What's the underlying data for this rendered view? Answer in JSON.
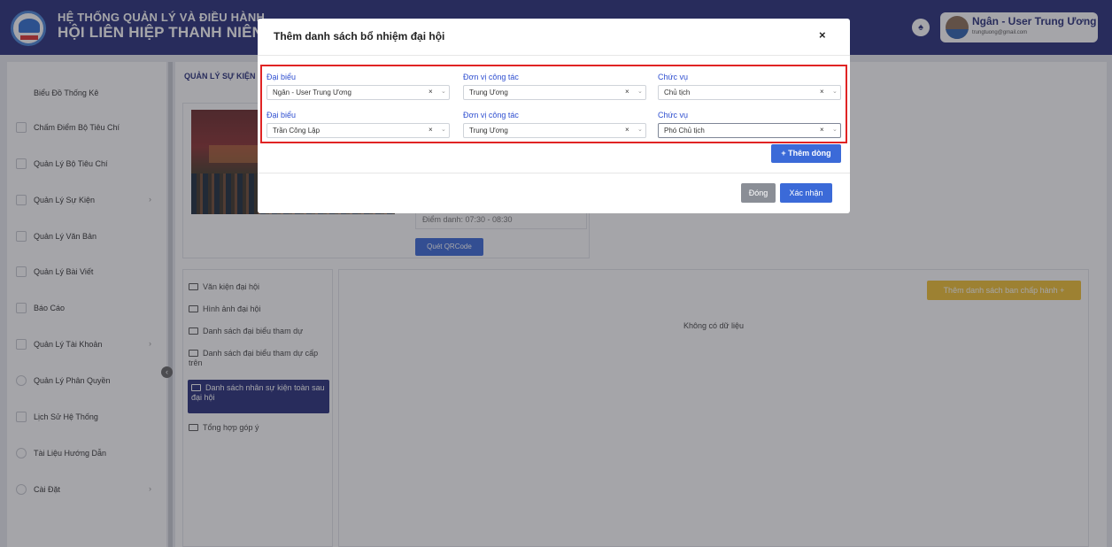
{
  "header": {
    "system_title_line1": "HỆ THỐNG QUẢN LÝ VÀ ĐIỀU HÀNH",
    "system_title_line2": "HỘI LIÊN HIỆP THANH NIÊN VIỆT",
    "user_name": "Ngân - User Trung Ương",
    "user_email": "trungtuong@gmail.com"
  },
  "sidebar": {
    "items": [
      {
        "label": "Biểu Đồ Thống Kê",
        "icon": "chart-icon"
      },
      {
        "label": "Chấm Điểm Bộ Tiêu Chí",
        "icon": "score-icon"
      },
      {
        "label": "Quản Lý Bộ Tiêu Chí",
        "icon": "pen-icon"
      },
      {
        "label": "Quản Lý Sự Kiện",
        "icon": "calendar-icon",
        "has_children": true
      },
      {
        "label": "Quản Lý Văn Bản",
        "icon": "document-icon"
      },
      {
        "label": "Quản Lý Bài Viết",
        "icon": "book-icon"
      },
      {
        "label": "Báo Cáo",
        "icon": "report-icon"
      },
      {
        "label": "Quản Lý Tài Khoản",
        "icon": "account-icon",
        "has_children": true
      },
      {
        "label": "Quản Lý Phân Quyền",
        "icon": "permission-icon"
      },
      {
        "label": "Lịch Sử Hệ Thống",
        "icon": "history-icon"
      },
      {
        "label": "Tài Liệu Hướng Dẫn",
        "icon": "info-icon"
      },
      {
        "label": "Cài Đặt",
        "icon": "settings-icon",
        "has_children": true
      }
    ],
    "chevron": "›",
    "collapse_glyph": "‹"
  },
  "main": {
    "breadcrumb": "QUẢN LÝ SỰ KIỆN",
    "event_time": "Điểm danh: 07:30 - 08:30",
    "qr_button": "Quét QRCode",
    "documents": [
      {
        "label": "Văn kiện đại hội"
      },
      {
        "label": "Hình ảnh đại hội"
      },
      {
        "label": "Danh sách đại biểu tham dự"
      },
      {
        "label": "Danh sách đại biểu tham dự cấp trên"
      },
      {
        "label": "Danh sách nhân sự kiện toàn sau đại hội",
        "active": true
      },
      {
        "label": "Tổng hợp góp ý"
      }
    ],
    "add_exec_button": "Thêm danh sách ban chấp hành +",
    "empty_text": "Không có dữ liệu"
  },
  "modal": {
    "title": "Thêm danh sách bổ nhiệm đại hội",
    "close_glyph": "×",
    "rows": [
      {
        "delegate_label": "Đại biểu",
        "delegate_value": "Ngân - User Trung Ương",
        "unit_label": "Đơn vị công tác",
        "unit_value": "Trung Ương",
        "position_label": "Chức vụ",
        "position_value": "Chủ tịch"
      },
      {
        "delegate_label": "Đại biểu",
        "delegate_value": "Trần Công Lập",
        "unit_label": "Đơn vị công tác",
        "unit_value": "Trung Ương",
        "position_label": "Chức vụ",
        "position_value": "Phó Chủ tịch"
      }
    ],
    "clear_glyph": "×",
    "arrow_glyph": "⌄",
    "add_row_button": "+ Thêm dòng",
    "close_button": "Đóng",
    "confirm_button": "Xác nhận",
    "highlight_color": "#e02424"
  },
  "colors": {
    "header_bg": "#28307a",
    "primary": "#3b6ad8",
    "warning": "#f1c232"
  }
}
